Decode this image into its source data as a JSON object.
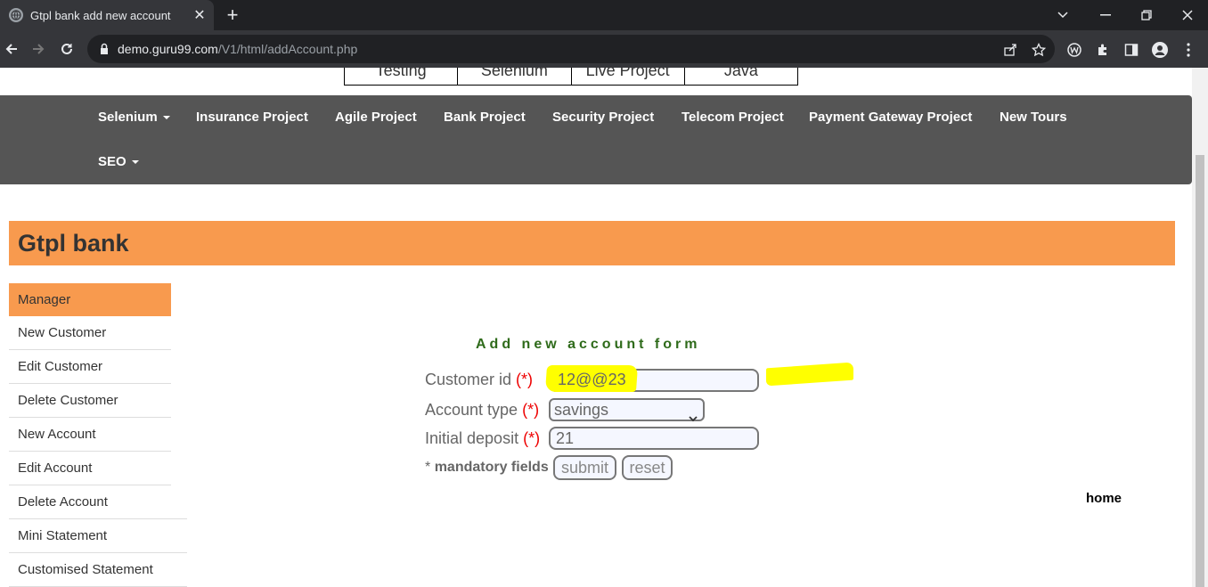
{
  "browser": {
    "tab_title": "Gtpl bank add new account",
    "new_tab_symbol": "+",
    "url_host": "demo.guru99.com",
    "url_path": "/V1/html/addAccount.php"
  },
  "top_links": [
    "Testing",
    "Selenium",
    "Live Project",
    "Java"
  ],
  "nav": {
    "items": [
      {
        "label": "Selenium",
        "dropdown": true
      },
      {
        "label": "Insurance Project"
      },
      {
        "label": "Agile Project"
      },
      {
        "label": "Bank Project"
      },
      {
        "label": "Security Project"
      },
      {
        "label": "Telecom Project"
      },
      {
        "label": "Payment Gateway Project"
      },
      {
        "label": "New Tours"
      },
      {
        "label": "SEO",
        "dropdown": true
      }
    ]
  },
  "banner": {
    "title": "Gtpl bank"
  },
  "sidebar": {
    "items": [
      {
        "label": "Manager",
        "active": true
      },
      {
        "label": "New Customer"
      },
      {
        "label": "Edit Customer"
      },
      {
        "label": "Delete Customer"
      },
      {
        "label": "New Account"
      },
      {
        "label": "Edit Account"
      },
      {
        "label": "Delete Account"
      },
      {
        "label": "Mini Statement"
      },
      {
        "label": "Customised Statement"
      }
    ]
  },
  "form": {
    "title": "Add new account form",
    "customer_id_label": "Customer id",
    "customer_id_value": "12@@23",
    "account_type_label": "Account type",
    "account_type_value": "savings",
    "initial_deposit_label": "Initial deposit",
    "initial_deposit_value": "21",
    "required_marker": "(*)",
    "mandatory_prefix": "*",
    "mandatory_text": "mandatory fields",
    "submit_label": "submit",
    "reset_label": "reset"
  },
  "home_link": "home",
  "colors": {
    "nav_bg": "#555555",
    "banner_bg": "#f89a4e",
    "form_title": "#2f6b1b",
    "required": "#ee0000",
    "highlight": "#ffff00"
  }
}
